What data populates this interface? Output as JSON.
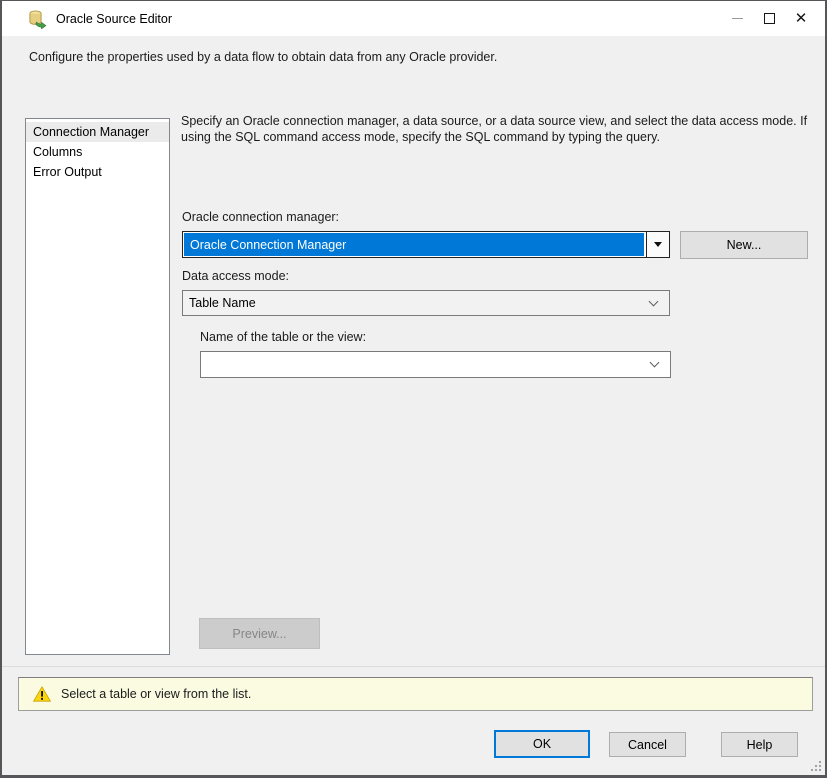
{
  "window": {
    "title": "Oracle Source Editor",
    "icons": {
      "app": "oracle-source-database-icon",
      "minimize": "minimize-icon",
      "maximize": "maximize-icon",
      "close": "close-icon"
    },
    "close_glyph": "✕"
  },
  "header": {
    "description": "Configure the properties used by a data flow to obtain data from any Oracle provider."
  },
  "sidebar": {
    "items": [
      {
        "label": "Connection Manager",
        "selected": true
      },
      {
        "label": "Columns",
        "selected": false
      },
      {
        "label": "Error Output",
        "selected": false
      }
    ]
  },
  "panel": {
    "description": "Specify an Oracle connection manager, a data source, or a data source view, and select the data access mode. If using the SQL command access mode, specify the SQL command by typing the query.",
    "connection_manager": {
      "label": "Oracle connection manager:",
      "value": "Oracle Connection Manager",
      "new_button": "New..."
    },
    "data_access_mode": {
      "label": "Data access mode:",
      "value": "Table Name"
    },
    "table_name": {
      "label": "Name of the table or the view:",
      "value": ""
    },
    "preview_button": "Preview..."
  },
  "warning": {
    "icon": "warning-triangle-icon",
    "message": "Select a table or view from the list."
  },
  "footer": {
    "ok": "OK",
    "cancel": "Cancel",
    "help": "Help"
  },
  "colors": {
    "selection_blue": "#0078d7",
    "warning_bg": "#fbfbe2",
    "disabled_bg": "#cccccc",
    "titlebar_bg": "#ffffff",
    "dialog_bg": "#f0f0f0"
  }
}
